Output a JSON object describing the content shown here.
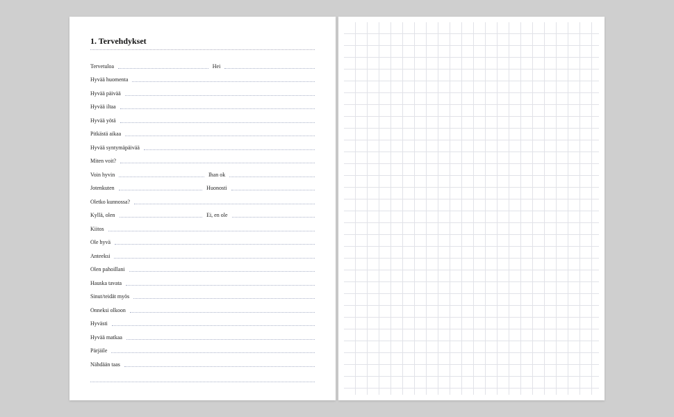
{
  "heading": "1. Tervehdykset",
  "rows": [
    {
      "a": "Tervetuloa",
      "b": "Hei"
    },
    {
      "a": "Hyvää huomenta"
    },
    {
      "a": "Hyvää päivää"
    },
    {
      "a": "Hyvää iltaa"
    },
    {
      "a": "Hyvää yötä"
    },
    {
      "a": "Pitkästä aikaa"
    },
    {
      "a": "Hyvää syntymäpäivää"
    },
    {
      "a": "Miten voit?"
    },
    {
      "a": "Voin hyvin",
      "b": "Ihan ok"
    },
    {
      "a": "Jotenkuten",
      "b": "Huonosti"
    },
    {
      "a": "Oletko kunnossa?"
    },
    {
      "a": "Kyllä, olen",
      "b": "Ei, en ole"
    },
    {
      "a": "Kiitos"
    },
    {
      "a": "Ole hyvä"
    },
    {
      "a": "Anteeksi"
    },
    {
      "a": "Olen pahoillani"
    },
    {
      "a": "Hauska tavata"
    },
    {
      "a": "Sinut/teidät myös"
    },
    {
      "a": "Onneksi olkoon"
    },
    {
      "a": "Hyvästi"
    },
    {
      "a": "Hyvää matkaa"
    },
    {
      "a": "Pärjäile"
    },
    {
      "a": "Nähdään taas"
    }
  ]
}
